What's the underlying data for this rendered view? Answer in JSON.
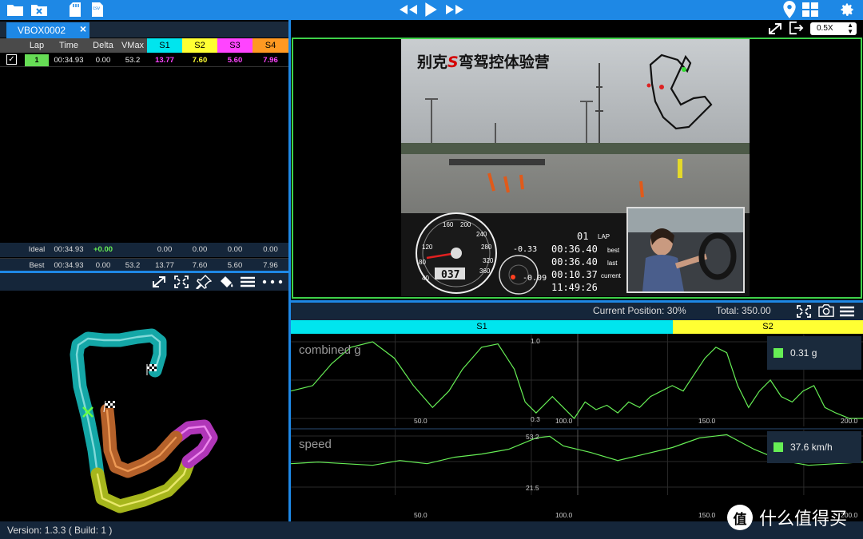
{
  "toolbar": {
    "icons": [
      "folder-icon",
      "close-file-icon",
      "sd-card-icon",
      "csv-file-icon",
      "rewind-icon",
      "play-icon",
      "fast-forward-icon",
      "location-pin-icon",
      "layout-grid-icon",
      "gear-icon"
    ],
    "csv_label": "csv"
  },
  "file_tab": {
    "name": "VBOX0002",
    "close": "×"
  },
  "lap_table": {
    "headers": [
      "Lap",
      "Time",
      "Delta",
      "VMax",
      "S1",
      "S2",
      "S3",
      "S4"
    ],
    "sector_colors": [
      "#00e5ee",
      "#ffff33",
      "#ff44ff",
      "#ff9922"
    ],
    "rows": [
      {
        "checked": "✓",
        "lap": "1",
        "time": "00:34.93",
        "delta": "0.00",
        "vmax": "53.2",
        "s1": "13.77",
        "s2": "7.60",
        "s3": "5.60",
        "s4": "7.96"
      }
    ],
    "ideal": {
      "label": "Ideal",
      "time": "00:34.93",
      "delta": "+0.00",
      "s1": "0.00",
      "s2": "0.00",
      "s3": "0.00",
      "s4": "0.00"
    },
    "best": {
      "label": "Best",
      "time": "00:34.93",
      "delta": "0.00",
      "vmax": "53.2",
      "s1": "13.77",
      "s2": "7.60",
      "s3": "5.60",
      "s4": "7.96"
    }
  },
  "map_toolbar": {
    "icons": [
      "expand-icon",
      "fit-screen-icon",
      "pin-icon",
      "paint-bucket-icon",
      "menu-icon",
      "more-icon"
    ]
  },
  "video": {
    "speed": "0.5X",
    "overlay_title_a": "别克",
    "overlay_title_s": "S",
    "overlay_title_b": "弯驾控体验营",
    "speedo_digits": "037",
    "speedo_ticks": [
      "40",
      "80",
      "120",
      "160",
      "200",
      "240",
      "280",
      "320",
      "360"
    ],
    "g_left": "-0.33",
    "g_right": "-0.09",
    "lap_no": "01",
    "lap_label": "LAP",
    "best_time": "00:36.40",
    "best_label": "best",
    "last_time": "00:36.40",
    "last_label": "last",
    "current_time": "00:10.37",
    "current_label": "current",
    "clock": "11:49:26"
  },
  "position_bar": {
    "current": "Current Position: 30%",
    "total": "Total: 350.00"
  },
  "sectors": [
    {
      "label": "S1",
      "color": "#00e5ee"
    },
    {
      "label": "S2",
      "color": "#ffff33"
    }
  ],
  "chart_data": [
    {
      "type": "line",
      "title": "combined g",
      "x_range": [
        0,
        210
      ],
      "x_ticks": [
        "50.0",
        "100.0",
        "150.0",
        "200.0"
      ],
      "y_ticks": [
        "1.0",
        "0.3"
      ],
      "legend_value": "0.31 g",
      "color": "#66ee55",
      "series": [
        {
          "x": [
            0,
            8,
            15,
            22,
            30,
            38,
            45,
            52,
            58,
            63,
            70,
            76,
            82,
            86,
            90,
            96,
            100,
            104,
            108,
            112,
            116,
            120,
            124,
            128,
            132,
            136,
            140,
            144,
            148,
            152,
            156,
            160,
            164,
            168,
            172,
            176,
            180,
            184,
            188,
            192,
            196,
            200,
            205,
            210
          ],
          "y": [
            0.55,
            0.6,
            0.8,
            0.95,
            1.0,
            0.85,
            0.6,
            0.4,
            0.55,
            0.75,
            0.95,
            0.98,
            0.75,
            0.45,
            0.35,
            0.5,
            0.4,
            0.3,
            0.45,
            0.38,
            0.42,
            0.35,
            0.45,
            0.4,
            0.5,
            0.55,
            0.6,
            0.55,
            0.7,
            0.85,
            0.95,
            0.9,
            0.6,
            0.4,
            0.55,
            0.65,
            0.5,
            0.45,
            0.55,
            0.6,
            0.4,
            0.35,
            0.3,
            0.3
          ]
        }
      ]
    },
    {
      "type": "line",
      "title": "speed",
      "x_range": [
        0,
        210
      ],
      "x_ticks": [
        "50.0",
        "100.0",
        "150.0",
        "200.0"
      ],
      "y_ticks": [
        "53.2",
        "21.5"
      ],
      "legend_value": "37.6 km/h",
      "color": "#66ee55",
      "series": [
        {
          "x": [
            0,
            10,
            20,
            30,
            40,
            50,
            60,
            70,
            80,
            90,
            95,
            100,
            110,
            120,
            130,
            140,
            150,
            160,
            170,
            180,
            190,
            200,
            210
          ],
          "y": [
            36,
            37,
            36,
            35,
            38,
            36,
            40,
            42,
            45,
            52,
            53,
            47,
            43,
            38,
            42,
            46,
            52,
            54,
            45,
            38,
            35,
            36,
            37
          ]
        }
      ]
    }
  ],
  "status": {
    "version": "Version: 1.3.3 ( Build: 1 )"
  },
  "watermark": {
    "logo": "值",
    "text": "什么值得买"
  }
}
